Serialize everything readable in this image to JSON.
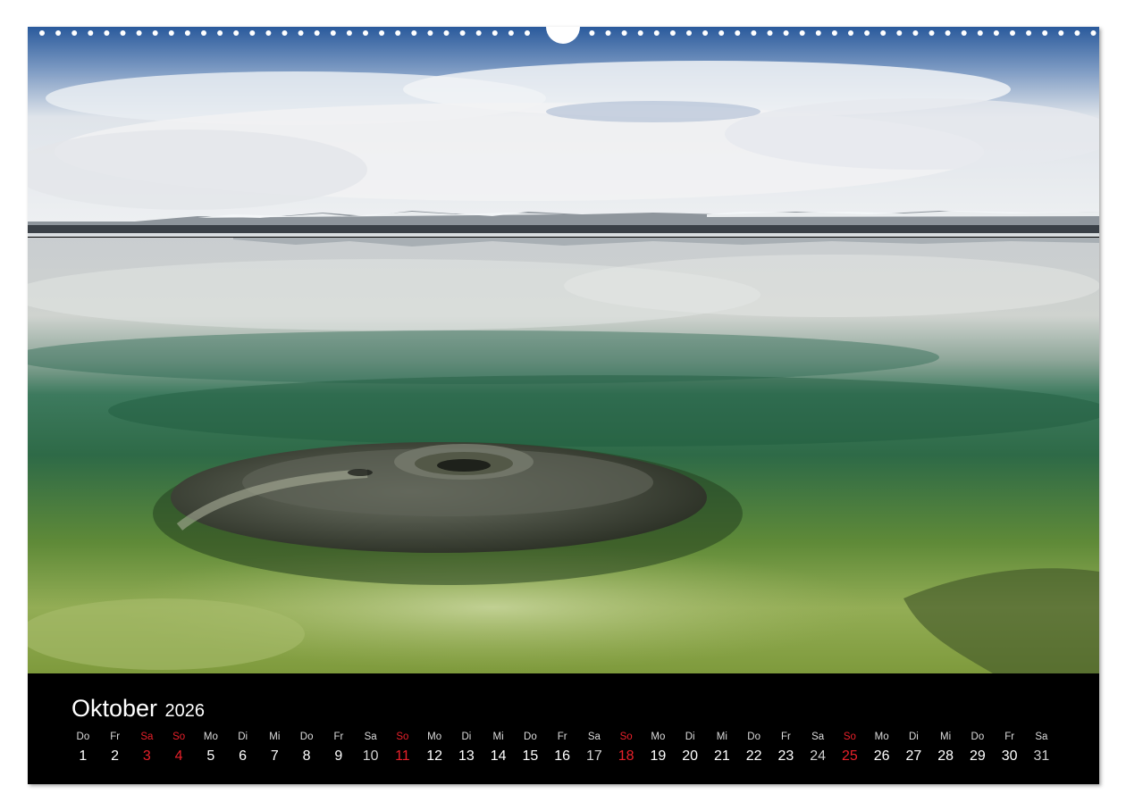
{
  "calendar": {
    "month": "Oktober",
    "year": "2026",
    "days": [
      {
        "dow": "Do",
        "num": "1",
        "kind": "normal"
      },
      {
        "dow": "Fr",
        "num": "2",
        "kind": "normal"
      },
      {
        "dow": "Sa",
        "num": "3",
        "kind": "holiday"
      },
      {
        "dow": "So",
        "num": "4",
        "kind": "sunday"
      },
      {
        "dow": "Mo",
        "num": "5",
        "kind": "normal"
      },
      {
        "dow": "Di",
        "num": "6",
        "kind": "normal"
      },
      {
        "dow": "Mi",
        "num": "7",
        "kind": "normal"
      },
      {
        "dow": "Do",
        "num": "8",
        "kind": "normal"
      },
      {
        "dow": "Fr",
        "num": "9",
        "kind": "normal"
      },
      {
        "dow": "Sa",
        "num": "10",
        "kind": "saturday"
      },
      {
        "dow": "So",
        "num": "11",
        "kind": "sunday"
      },
      {
        "dow": "Mo",
        "num": "12",
        "kind": "normal"
      },
      {
        "dow": "Di",
        "num": "13",
        "kind": "normal"
      },
      {
        "dow": "Mi",
        "num": "14",
        "kind": "normal"
      },
      {
        "dow": "Do",
        "num": "15",
        "kind": "normal"
      },
      {
        "dow": "Fr",
        "num": "16",
        "kind": "normal"
      },
      {
        "dow": "Sa",
        "num": "17",
        "kind": "saturday"
      },
      {
        "dow": "So",
        "num": "18",
        "kind": "sunday"
      },
      {
        "dow": "Mo",
        "num": "19",
        "kind": "normal"
      },
      {
        "dow": "Di",
        "num": "20",
        "kind": "normal"
      },
      {
        "dow": "Mi",
        "num": "21",
        "kind": "normal"
      },
      {
        "dow": "Do",
        "num": "22",
        "kind": "normal"
      },
      {
        "dow": "Fr",
        "num": "23",
        "kind": "normal"
      },
      {
        "dow": "Sa",
        "num": "24",
        "kind": "saturday"
      },
      {
        "dow": "So",
        "num": "25",
        "kind": "sunday"
      },
      {
        "dow": "Mo",
        "num": "26",
        "kind": "normal"
      },
      {
        "dow": "Di",
        "num": "27",
        "kind": "normal"
      },
      {
        "dow": "Mi",
        "num": "28",
        "kind": "normal"
      },
      {
        "dow": "Do",
        "num": "29",
        "kind": "normal"
      },
      {
        "dow": "Fr",
        "num": "30",
        "kind": "normal"
      },
      {
        "dow": "Sa",
        "num": "31",
        "kind": "saturday"
      }
    ]
  },
  "colors": {
    "strip_background": "#000000",
    "sunday_red": "#e8202a"
  }
}
